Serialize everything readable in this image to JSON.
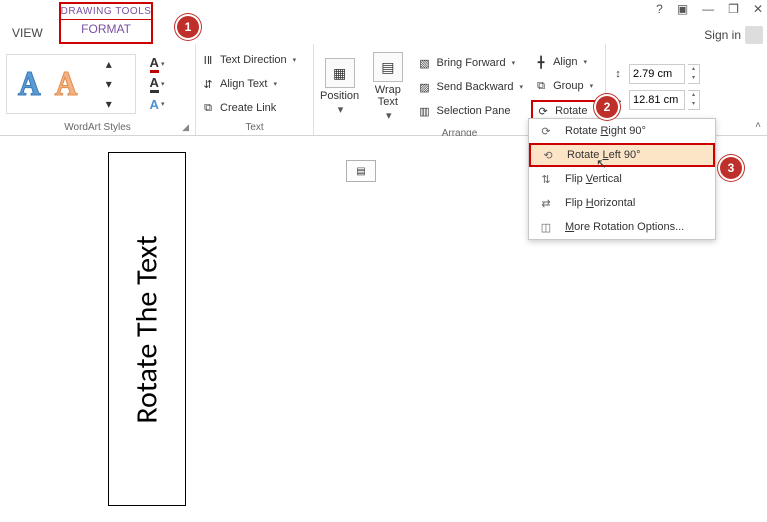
{
  "titlebar": {
    "view_tab": "VIEW",
    "contextual_title": "DRAWING TOOLS",
    "contextual_tab": "FORMAT",
    "help": "?",
    "present": "▣",
    "minimize": "—",
    "restore": "❐",
    "close": "✕",
    "signin": "Sign in"
  },
  "groups": {
    "wordart": {
      "label": "WordArt Styles"
    },
    "text": {
      "label": "Text",
      "direction": "Text Direction",
      "align": "Align Text",
      "link": "Create Link"
    },
    "position": {
      "label": "Position"
    },
    "wrap": {
      "label": "Wrap Text"
    },
    "arrange": {
      "label": "Arrange",
      "forward": "Bring Forward",
      "backward": "Send Backward",
      "selpane": "Selection Pane",
      "align": "Align",
      "group": "Group",
      "rotate": "Rotate"
    },
    "size": {
      "height": "2.79 cm",
      "width": "12.81 cm"
    }
  },
  "menu": {
    "right": "Rotate Right 90°",
    "left": "Rotate Left 90°",
    "flipv": "Flip Vertical",
    "fliph": "Flip Horizontal",
    "more": "More Rotation Options...",
    "ul": {
      "r": "R",
      "l": "L",
      "v": "V",
      "h": "H",
      "m": "M"
    }
  },
  "doc": {
    "text": "Rotate The Text"
  },
  "badges": {
    "b1": "1",
    "b2": "2",
    "b3": "3"
  }
}
